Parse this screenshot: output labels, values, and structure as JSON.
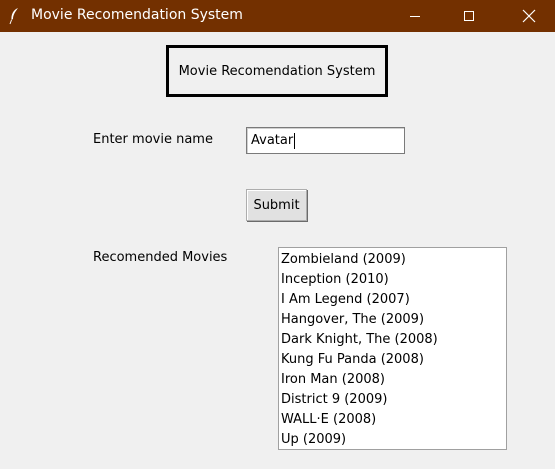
{
  "window": {
    "title": "Movie Recomendation System",
    "titlebar_color": "#733000",
    "icon": "feather-icon",
    "controls": [
      "minimize-icon",
      "maximize-icon",
      "close-icon"
    ]
  },
  "main": {
    "heading": "Movie Recomendation System",
    "movie_label": "Enter movie name",
    "movie_value": "Avatar",
    "submit_label": "Submit",
    "recommended_label": "Recomended Movies",
    "recommendations": [
      "Zombieland (2009)",
      "Inception (2010)",
      "I Am Legend (2007)",
      "Hangover, The (2009)",
      "Dark Knight, The (2008)",
      "Kung Fu Panda (2008)",
      "Iron Man (2008)",
      "District 9 (2009)",
      "WALL·E (2008)",
      "Up (2009)"
    ]
  }
}
